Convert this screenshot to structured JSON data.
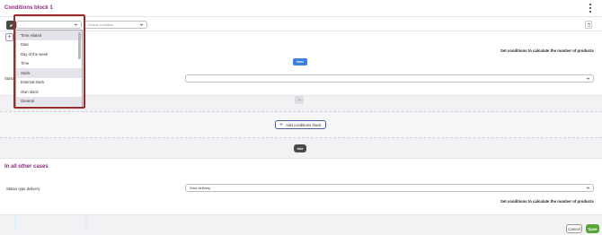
{
  "block": {
    "title": "Conditions block 1",
    "if_label": "IF",
    "field_select_value": "",
    "operator_placeholder": "Select condition",
    "hint": "Set conditions to calculate the number of products",
    "then_label": "then",
    "status_label": "Status",
    "status_value": ""
  },
  "dropdown": {
    "options": [
      {
        "label": "Time related",
        "selected": true
      },
      {
        "label": "Date",
        "selected": false
      },
      {
        "label": "Day of the week",
        "selected": false
      },
      {
        "label": "Time",
        "selected": false
      },
      {
        "label": "Stock",
        "selected": true
      },
      {
        "label": "External stock",
        "selected": false
      },
      {
        "label": "Own stock",
        "selected": false
      },
      {
        "label": "General",
        "selected": true
      }
    ]
  },
  "add_block": {
    "label": "Add conditions block",
    "icon": "plus-icon"
  },
  "else_label": "else",
  "otherwise": {
    "title": "In all other cases",
    "status_label": "Status type delivery",
    "status_value": "Own delivery",
    "hint": "Set conditions to calculate the number of products"
  },
  "footer": {
    "cancel_label": "Cancel",
    "save_label": "Save"
  },
  "colors": {
    "accent": "#8e2a7d",
    "primary": "#3d7ee0",
    "save": "#5aa33a",
    "highlight": "#9d2a2a"
  }
}
